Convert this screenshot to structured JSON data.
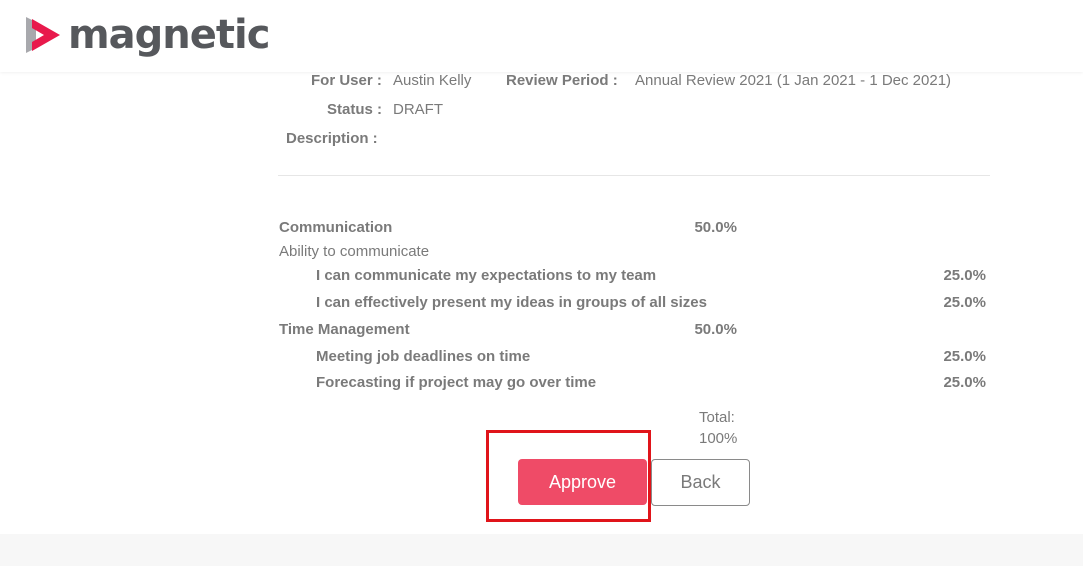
{
  "app": {
    "brand": "magnetic",
    "brand_color": "#e8194c",
    "accent_color": "#ef4b67",
    "highlight_color": "#e0141a"
  },
  "review": {
    "user_label": "For User :",
    "user_value": "Austin Kelly",
    "period_label": "Review Period :",
    "period_value": "Annual Review 2021 (1 Jan 2021 - 1 Dec 2021)",
    "status_label": "Status :",
    "status_value": "DRAFT",
    "description_label": "Description :"
  },
  "competencies": [
    {
      "name": "Communication",
      "weight": "50.0%",
      "description": "Ability to communicate",
      "items": [
        {
          "name": "I can communicate my expectations to my team",
          "weight": "25.0%"
        },
        {
          "name": "I can effectively present my ideas in groups of all sizes",
          "weight": "25.0%"
        }
      ]
    },
    {
      "name": "Time Management",
      "weight": "50.0%",
      "items": [
        {
          "name": "Meeting job deadlines on time",
          "weight": "25.0%"
        },
        {
          "name": "Forecasting if project may go over time",
          "weight": "25.0%"
        }
      ]
    }
  ],
  "total": {
    "label": "Total:",
    "value": "100%"
  },
  "actions": {
    "approve_label": "Approve",
    "back_label": "Back"
  }
}
